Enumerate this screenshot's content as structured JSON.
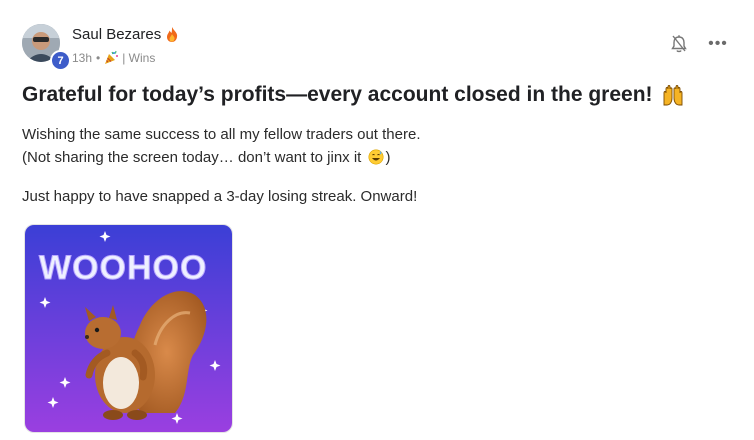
{
  "post": {
    "author": {
      "name": "Saul Bezares",
      "level": "7",
      "avatar_icon": "user-avatar-photo",
      "status_icon": "flame-icon"
    },
    "meta": {
      "time": "13h",
      "separator": "•",
      "category_icon": "party-popper-icon",
      "category": "| Wins"
    },
    "actions": {
      "notify_icon": "bell-icon",
      "more_icon": "more-dots-icon",
      "more_label": "•••"
    },
    "title": "Grateful for today’s profits—every account closed in the green!",
    "title_icon": "raising-hands-icon",
    "body": {
      "line1": "Wishing the same success to all my fellow traders out there.",
      "line2_pre": "(Not sharing the screen today… don’t want to jinx it",
      "line2_icon": "grinning-sweat-icon",
      "line2_post": ")",
      "line3": "Just happy to have snapped a 3-day losing streak. Onward!"
    },
    "gif": {
      "text": "WOOHOO",
      "subject": "squirrel",
      "colors": {
        "top": "#3b3fd6",
        "bottom": "#9a3fe0"
      }
    }
  }
}
